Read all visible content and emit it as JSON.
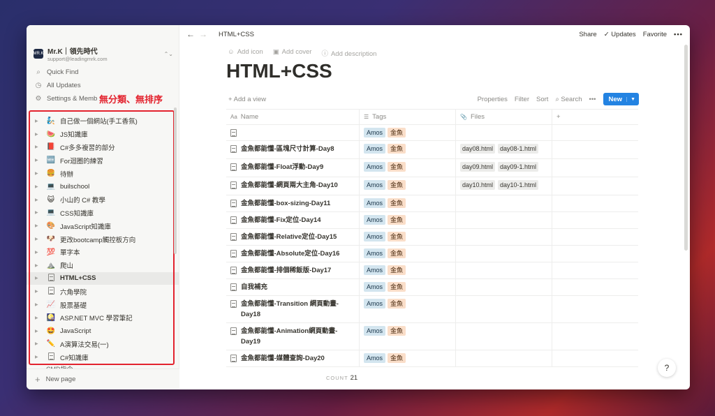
{
  "workspace": {
    "name": "Mr.K｜領先時代",
    "email": "support@leadingmrk.com",
    "logo_text": "MR.K"
  },
  "nav": [
    {
      "label": "Quick Find",
      "icon": "search-icon"
    },
    {
      "label": "All Updates",
      "icon": "clock-icon"
    },
    {
      "label": "Settings & Memb",
      "icon": "gear-icon"
    }
  ],
  "annotation": "無分類、無排序",
  "sidebar_pages": [
    {
      "emoji": "🧞",
      "label": "自己做一個網站(手工香氛)"
    },
    {
      "emoji": "🍉",
      "label": "JS知識庫"
    },
    {
      "emoji": "📕",
      "label": "C#多多複習的部分"
    },
    {
      "emoji": "🆕",
      "label": "For迴圈的練習"
    },
    {
      "emoji": "🍔",
      "label": "待辦"
    },
    {
      "emoji": "💻",
      "label": "builschool"
    },
    {
      "emoji": "😺",
      "label": "小山的 C# 教學"
    },
    {
      "emoji": "💻",
      "label": "CSS知識庫"
    },
    {
      "emoji": "🎨",
      "label": "JavaScript知識庫"
    },
    {
      "emoji": "🐶",
      "label": "更改bootcamp觸控板方向"
    },
    {
      "emoji": "💯",
      "label": "單字本"
    },
    {
      "emoji": "⛰️",
      "label": "爬山"
    },
    {
      "emoji": "",
      "label": "HTML+CSS",
      "active": true
    },
    {
      "emoji": "",
      "label": "六角學院"
    },
    {
      "emoji": "📈",
      "label": "股票基礎"
    },
    {
      "emoji": "🎑",
      "label": "ASP.NET MVC 學習筆記"
    },
    {
      "emoji": "🤩",
      "label": "JavaScript"
    },
    {
      "emoji": "✏️",
      "label": "A演算法交易(一)"
    },
    {
      "emoji": "",
      "label": "C#知識庫"
    }
  ],
  "sidebar_cut_label": "CMD指令",
  "new_page": "New page",
  "topbar": {
    "breadcrumb": "HTML+CSS",
    "share": "Share",
    "updates": "Updates",
    "favorite": "Favorite",
    "more": "•••"
  },
  "page_actions": {
    "add_icon": "Add icon",
    "add_cover": "Add cover",
    "add_description": "Add description"
  },
  "title": "HTML+CSS",
  "viewbar": {
    "add_view": "+ Add a view",
    "properties": "Properties",
    "filter": "Filter",
    "sort": "Sort",
    "search": "Search",
    "more": "•••",
    "new": "New"
  },
  "columns": {
    "name": "Name",
    "tags": "Tags",
    "files": "Files",
    "add": "+"
  },
  "rows": [
    {
      "name": "",
      "tags": [
        "Amos",
        "金魚"
      ],
      "files": []
    },
    {
      "name": "金魚都能懂-區塊尺寸計算-Day8",
      "tags": [
        "Amos",
        "金魚"
      ],
      "files": [
        "day08.html",
        "day08-1.html"
      ]
    },
    {
      "name": "金魚都能懂-Float浮動-Day9",
      "tags": [
        "Amos",
        "金魚"
      ],
      "files": [
        "day09.html",
        "day09-1.html"
      ]
    },
    {
      "name": "金魚都能懂-網頁兩大主角-Day10",
      "tags": [
        "Amos",
        "金魚"
      ],
      "files": [
        "day10.html",
        "day10-1.html"
      ]
    },
    {
      "name": "金魚都能懂-box-sizing-Day11",
      "tags": [
        "Amos",
        "金魚"
      ],
      "files": []
    },
    {
      "name": "金魚都能懂-Fix定位-Day14",
      "tags": [
        "Amos",
        "金魚"
      ],
      "files": []
    },
    {
      "name": "金魚都能懂-Relative定位-Day15",
      "tags": [
        "Amos",
        "金魚"
      ],
      "files": []
    },
    {
      "name": "金魚都能懂-Absolute定位-Day16",
      "tags": [
        "Amos",
        "金魚"
      ],
      "files": []
    },
    {
      "name": "金魚都能懂-排個稀飯版-Day17",
      "tags": [
        "Amos",
        "金魚"
      ],
      "files": []
    },
    {
      "name": "自我補充",
      "tags": [
        "Amos",
        "金魚"
      ],
      "files": []
    },
    {
      "name": "金魚都能懂-Transition 網頁動畫-Day18",
      "tags": [
        "Amos",
        "金魚"
      ],
      "files": []
    },
    {
      "name": "金魚都能懂-Animation網頁動畫-Day19",
      "tags": [
        "Amos",
        "金魚"
      ],
      "files": []
    },
    {
      "name": "金魚都能懂-媒體查詢-Day20",
      "tags": [
        "Amos",
        "金魚"
      ],
      "files": []
    }
  ],
  "count": {
    "label": "COUNT",
    "value": "21"
  },
  "help": "?"
}
